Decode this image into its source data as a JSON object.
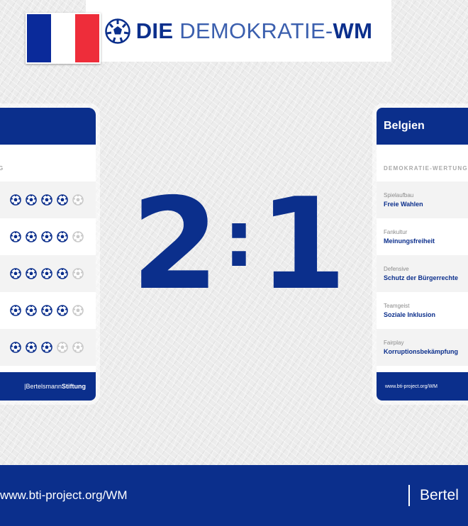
{
  "header": {
    "logo_bold_1": "DIE",
    "logo_light": "DEMOKRATIE-",
    "logo_bold_2": "WM",
    "logo_icon": "soccer-ball-icon"
  },
  "left_card": {
    "country_flag": "france-flag",
    "section_label": "G",
    "ratings": [
      4,
      4,
      4,
      4,
      3
    ],
    "max_rating": 5,
    "footer_brand_plain": "Bertelsmann",
    "footer_brand_bold": "Stiftung"
  },
  "score": {
    "left": "2",
    "separator": ":",
    "right": "1"
  },
  "right_card": {
    "country": "Belgien",
    "section_label": "DEMOKRATIE-WERTUNG",
    "rows": [
      {
        "category": "Spielaufbau",
        "value": "Freie Wahlen"
      },
      {
        "category": "Fankultur",
        "value": "Meinungsfreiheit"
      },
      {
        "category": "Defensive",
        "value": "Schutz der Bürgerrechte"
      },
      {
        "category": "Teamgeist",
        "value": "Soziale Inklusion"
      },
      {
        "category": "Fairplay",
        "value": "Korruptionsbekämpfung"
      }
    ],
    "footer_url": "www.bti-project.org/WM"
  },
  "footer": {
    "url": "www.bti-project.org/WM",
    "brand": "Bertel"
  },
  "colors": {
    "brand_blue": "#0b2f8c",
    "flag_blue": "#0a2a9a",
    "flag_red": "#ee2d3a"
  }
}
